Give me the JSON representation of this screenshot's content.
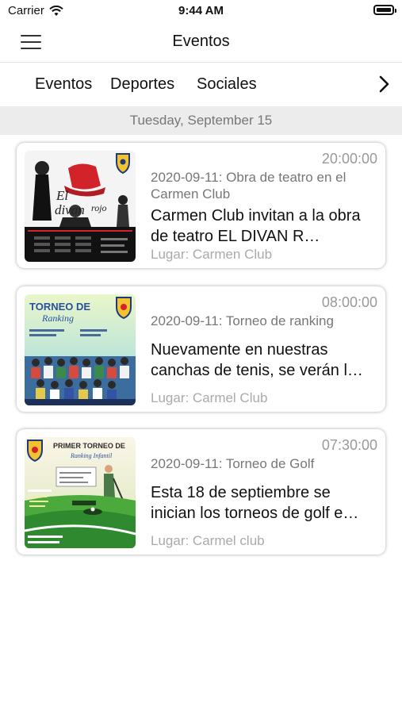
{
  "status": {
    "carrier": "Carrier",
    "time": "9:44 AM"
  },
  "nav": {
    "title": "Eventos"
  },
  "tabs": [
    "Eventos",
    "Deportes",
    "Sociales"
  ],
  "date_header": "Tuesday, September 15",
  "events": [
    {
      "time": "20:00:00",
      "title": "2020-09-11: Obra de teatro en el Carmen Club",
      "description": "Carmen Club  invitan a la obra de teatro EL DIVAN R…",
      "place": "Lugar: Carmen Club",
      "image_text": "El divan rojo"
    },
    {
      "time": "08:00:00",
      "title": "2020-09-11: Torneo de ranking",
      "description": "Nuevamente en nuestras canchas de tenis, se verán l…",
      "place": "Lugar: Carmel Club",
      "image_text": "TORNEO DE Ranking"
    },
    {
      "time": "07:30:00",
      "title": "2020-09-11: Torneo de Golf",
      "description": "Esta 18 de septiembre se inician los torneos de golf e…",
      "place": "Lugar: Carmel club",
      "image_text": "PRIMER TORNEO DE Ranking Infantil"
    }
  ]
}
